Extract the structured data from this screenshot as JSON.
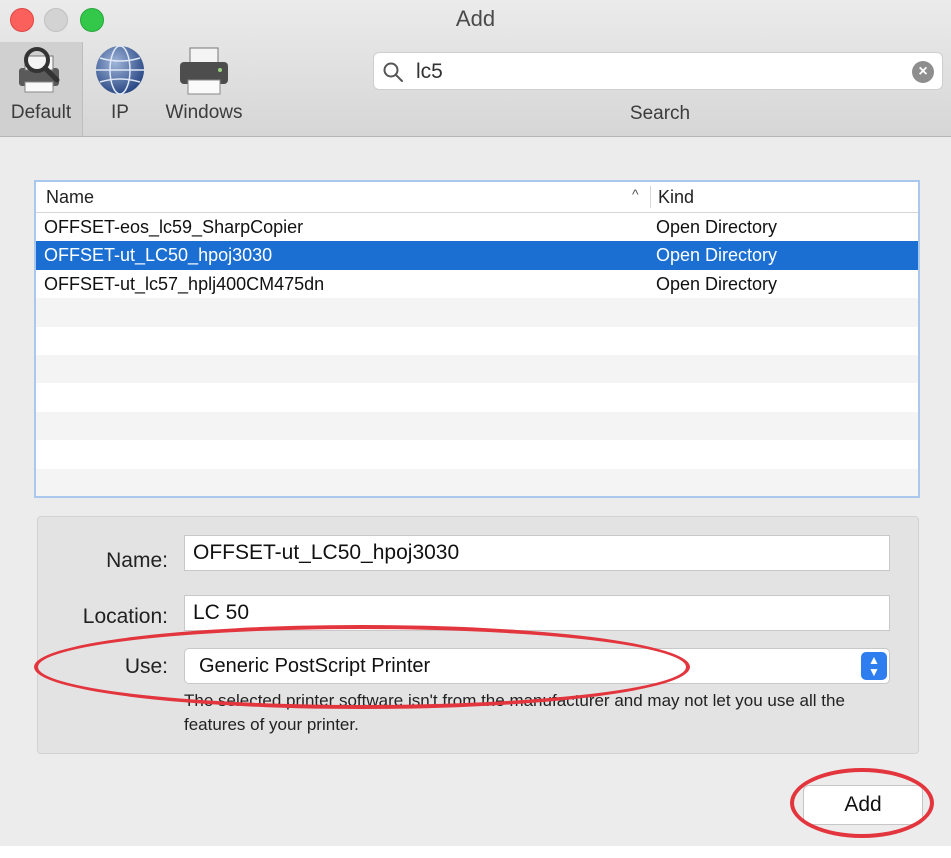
{
  "window": {
    "title": "Add"
  },
  "toolbar": {
    "buttons": [
      {
        "label": "Default",
        "icon": "default-printer-icon"
      },
      {
        "label": "IP",
        "icon": "globe-icon"
      },
      {
        "label": "Windows",
        "icon": "windows-printer-icon"
      }
    ],
    "search": {
      "value": "lc5",
      "label": "Search"
    }
  },
  "table": {
    "columns": {
      "name": "Name",
      "kind": "Kind"
    },
    "rows": [
      {
        "name": "OFFSET-eos_lc59_SharpCopier",
        "kind": "Open Directory"
      },
      {
        "name": "OFFSET-ut_LC50_hpoj3030",
        "kind": "Open Directory"
      },
      {
        "name": "OFFSET-ut_lc57_hplj400CM475dn",
        "kind": "Open Directory"
      }
    ]
  },
  "details": {
    "name_label": "Name:",
    "name_value": "OFFSET-ut_LC50_hpoj3030",
    "location_label": "Location:",
    "location_value": "LC 50",
    "use_label": "Use:",
    "use_value": "Generic PostScript Printer",
    "note": "The selected printer software isn't from the manufacturer and may not let you use all the features of your printer."
  },
  "actions": {
    "add_label": "Add"
  },
  "colors": {
    "selection": "#1b6fd2",
    "annotation": "#e3353d",
    "stepper": "#2f7ef0"
  }
}
